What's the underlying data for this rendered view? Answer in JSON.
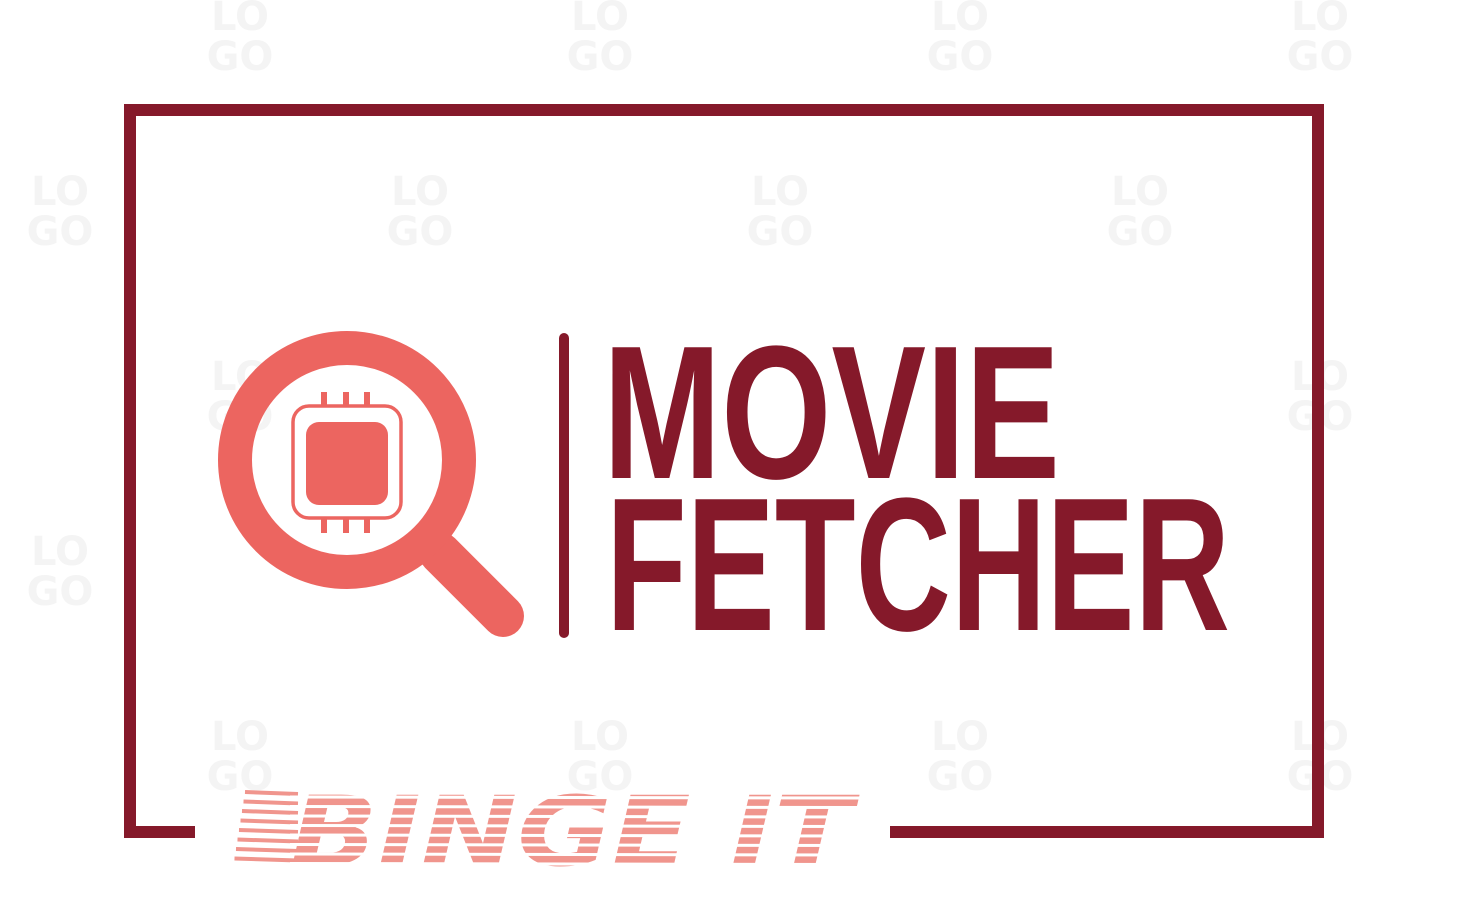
{
  "logo": {
    "title_line1": "MOVIE",
    "title_line2": "FETCHER",
    "tagline": "BINGE IT",
    "icon": "magnifier-chip-icon",
    "watermark": "LOGO"
  },
  "colors": {
    "frame": "#85192a",
    "title": "#85192a",
    "icon": "#ec6560",
    "tagline": "#f0958d"
  }
}
